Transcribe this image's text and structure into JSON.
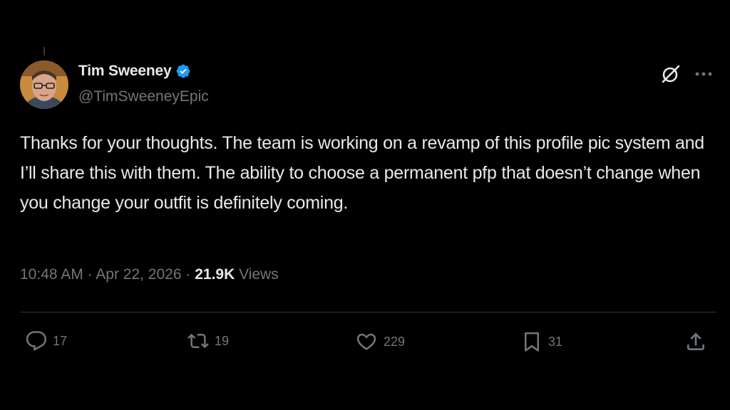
{
  "author": {
    "display_name": "Tim Sweeney",
    "handle": "@TimSweeneyEpic",
    "verified": true
  },
  "tweet": {
    "text": "Thanks for your thoughts. The team is working on a revamp of this profile pic system and I’ll share this with them. The ability to choose a permanent pfp that doesn’t change when you change your outfit is definitely coming.",
    "time": "10:48 AM",
    "date": "Apr 22, 2026",
    "separator": "·",
    "views_count": "21.9K",
    "views_label": "Views"
  },
  "actions": {
    "replies": "17",
    "reposts": "19",
    "likes": "229",
    "bookmarks": "31"
  },
  "icons": {
    "verified": "verified-badge-icon",
    "grok": "grok-icon",
    "more": "more-horizontal-icon",
    "reply": "reply-icon",
    "repost": "repost-icon",
    "like": "heart-icon",
    "bookmark": "bookmark-icon",
    "share": "share-icon"
  },
  "colors": {
    "background": "#000000",
    "text_primary": "#e7e9ea",
    "text_secondary": "#71767b",
    "divider": "#2f3336",
    "verified_blue": "#1d9bf0"
  }
}
